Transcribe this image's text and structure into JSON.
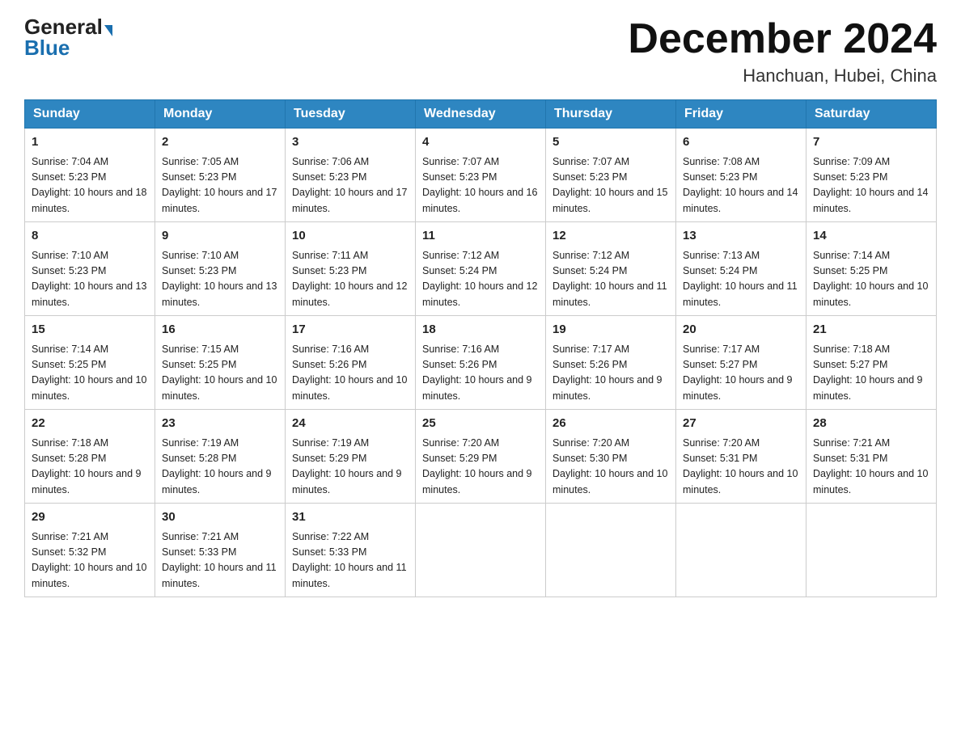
{
  "header": {
    "logo_general": "General",
    "logo_blue": "Blue",
    "month_title": "December 2024",
    "location": "Hanchuan, Hubei, China"
  },
  "days_of_week": [
    "Sunday",
    "Monday",
    "Tuesday",
    "Wednesday",
    "Thursday",
    "Friday",
    "Saturday"
  ],
  "weeks": [
    [
      {
        "day": "1",
        "sunrise": "7:04 AM",
        "sunset": "5:23 PM",
        "daylight": "10 hours and 18 minutes."
      },
      {
        "day": "2",
        "sunrise": "7:05 AM",
        "sunset": "5:23 PM",
        "daylight": "10 hours and 17 minutes."
      },
      {
        "day": "3",
        "sunrise": "7:06 AM",
        "sunset": "5:23 PM",
        "daylight": "10 hours and 17 minutes."
      },
      {
        "day": "4",
        "sunrise": "7:07 AM",
        "sunset": "5:23 PM",
        "daylight": "10 hours and 16 minutes."
      },
      {
        "day": "5",
        "sunrise": "7:07 AM",
        "sunset": "5:23 PM",
        "daylight": "10 hours and 15 minutes."
      },
      {
        "day": "6",
        "sunrise": "7:08 AM",
        "sunset": "5:23 PM",
        "daylight": "10 hours and 14 minutes."
      },
      {
        "day": "7",
        "sunrise": "7:09 AM",
        "sunset": "5:23 PM",
        "daylight": "10 hours and 14 minutes."
      }
    ],
    [
      {
        "day": "8",
        "sunrise": "7:10 AM",
        "sunset": "5:23 PM",
        "daylight": "10 hours and 13 minutes."
      },
      {
        "day": "9",
        "sunrise": "7:10 AM",
        "sunset": "5:23 PM",
        "daylight": "10 hours and 13 minutes."
      },
      {
        "day": "10",
        "sunrise": "7:11 AM",
        "sunset": "5:23 PM",
        "daylight": "10 hours and 12 minutes."
      },
      {
        "day": "11",
        "sunrise": "7:12 AM",
        "sunset": "5:24 PM",
        "daylight": "10 hours and 12 minutes."
      },
      {
        "day": "12",
        "sunrise": "7:12 AM",
        "sunset": "5:24 PM",
        "daylight": "10 hours and 11 minutes."
      },
      {
        "day": "13",
        "sunrise": "7:13 AM",
        "sunset": "5:24 PM",
        "daylight": "10 hours and 11 minutes."
      },
      {
        "day": "14",
        "sunrise": "7:14 AM",
        "sunset": "5:25 PM",
        "daylight": "10 hours and 10 minutes."
      }
    ],
    [
      {
        "day": "15",
        "sunrise": "7:14 AM",
        "sunset": "5:25 PM",
        "daylight": "10 hours and 10 minutes."
      },
      {
        "day": "16",
        "sunrise": "7:15 AM",
        "sunset": "5:25 PM",
        "daylight": "10 hours and 10 minutes."
      },
      {
        "day": "17",
        "sunrise": "7:16 AM",
        "sunset": "5:26 PM",
        "daylight": "10 hours and 10 minutes."
      },
      {
        "day": "18",
        "sunrise": "7:16 AM",
        "sunset": "5:26 PM",
        "daylight": "10 hours and 9 minutes."
      },
      {
        "day": "19",
        "sunrise": "7:17 AM",
        "sunset": "5:26 PM",
        "daylight": "10 hours and 9 minutes."
      },
      {
        "day": "20",
        "sunrise": "7:17 AM",
        "sunset": "5:27 PM",
        "daylight": "10 hours and 9 minutes."
      },
      {
        "day": "21",
        "sunrise": "7:18 AM",
        "sunset": "5:27 PM",
        "daylight": "10 hours and 9 minutes."
      }
    ],
    [
      {
        "day": "22",
        "sunrise": "7:18 AM",
        "sunset": "5:28 PM",
        "daylight": "10 hours and 9 minutes."
      },
      {
        "day": "23",
        "sunrise": "7:19 AM",
        "sunset": "5:28 PM",
        "daylight": "10 hours and 9 minutes."
      },
      {
        "day": "24",
        "sunrise": "7:19 AM",
        "sunset": "5:29 PM",
        "daylight": "10 hours and 9 minutes."
      },
      {
        "day": "25",
        "sunrise": "7:20 AM",
        "sunset": "5:29 PM",
        "daylight": "10 hours and 9 minutes."
      },
      {
        "day": "26",
        "sunrise": "7:20 AM",
        "sunset": "5:30 PM",
        "daylight": "10 hours and 10 minutes."
      },
      {
        "day": "27",
        "sunrise": "7:20 AM",
        "sunset": "5:31 PM",
        "daylight": "10 hours and 10 minutes."
      },
      {
        "day": "28",
        "sunrise": "7:21 AM",
        "sunset": "5:31 PM",
        "daylight": "10 hours and 10 minutes."
      }
    ],
    [
      {
        "day": "29",
        "sunrise": "7:21 AM",
        "sunset": "5:32 PM",
        "daylight": "10 hours and 10 minutes."
      },
      {
        "day": "30",
        "sunrise": "7:21 AM",
        "sunset": "5:33 PM",
        "daylight": "10 hours and 11 minutes."
      },
      {
        "day": "31",
        "sunrise": "7:22 AM",
        "sunset": "5:33 PM",
        "daylight": "10 hours and 11 minutes."
      },
      null,
      null,
      null,
      null
    ]
  ]
}
